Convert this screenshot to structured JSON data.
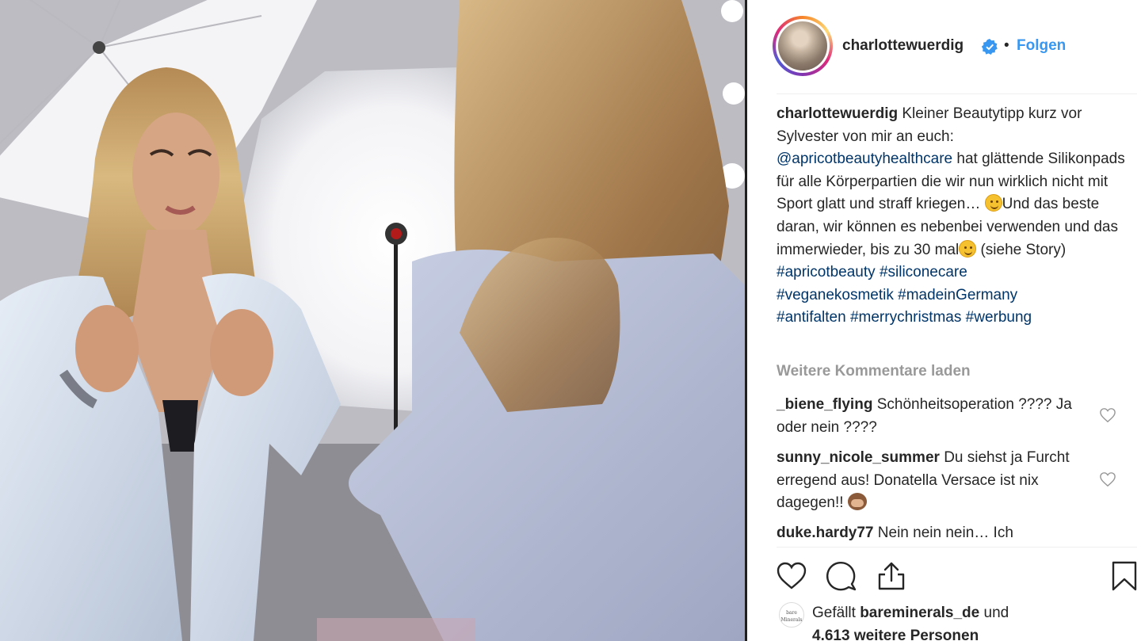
{
  "post": {
    "author": {
      "username": "charlottewuerdig",
      "verified_icon": "verified-badge-icon",
      "separator": "•",
      "follow_label": "Folgen"
    },
    "caption": {
      "username": "charlottewuerdig",
      "text_1": "Kleiner Beautytipp kurz vor Sylvester von mir an euch:",
      "mention": "@apricotbeautyhealthcare",
      "text_2": "hat glättende Silikonpads für alle Körperpartien die wir nun wirklich nicht mit Sport glatt und straff kriegen…",
      "text_3": "Und das beste daran, wir können es nebenbei verwenden und das immerwieder, bis zu 30 mal",
      "text_4": "(siehe Story)",
      "hashtags": [
        "#apricotbeauty",
        "#siliconecare",
        "#veganekosmetik",
        "#madeinGermany",
        "#antifalten",
        "#merrychristmas",
        "#werbung"
      ]
    },
    "load_more_label": "Weitere Kommentare laden",
    "comments": [
      {
        "username": "_biene_flying",
        "text": "Schönheitsoperation ???? Ja oder nein ????"
      },
      {
        "username": "sunny_nicole_summer",
        "text": "Du siehst ja Furcht erregend aus! Donatella Versace ist nix dagegen!!"
      },
      {
        "username": "duke.hardy77",
        "text": "Nein nein nein… Ich"
      }
    ],
    "actions": [
      "heart-icon",
      "comment-icon",
      "share-icon",
      "bookmark-icon"
    ],
    "likes": {
      "avatar_text": "bare Minerals",
      "prefix": "Gefällt",
      "user": "bareminerals_de",
      "connector": "und",
      "others": "4.613 weitere Personen"
    }
  }
}
